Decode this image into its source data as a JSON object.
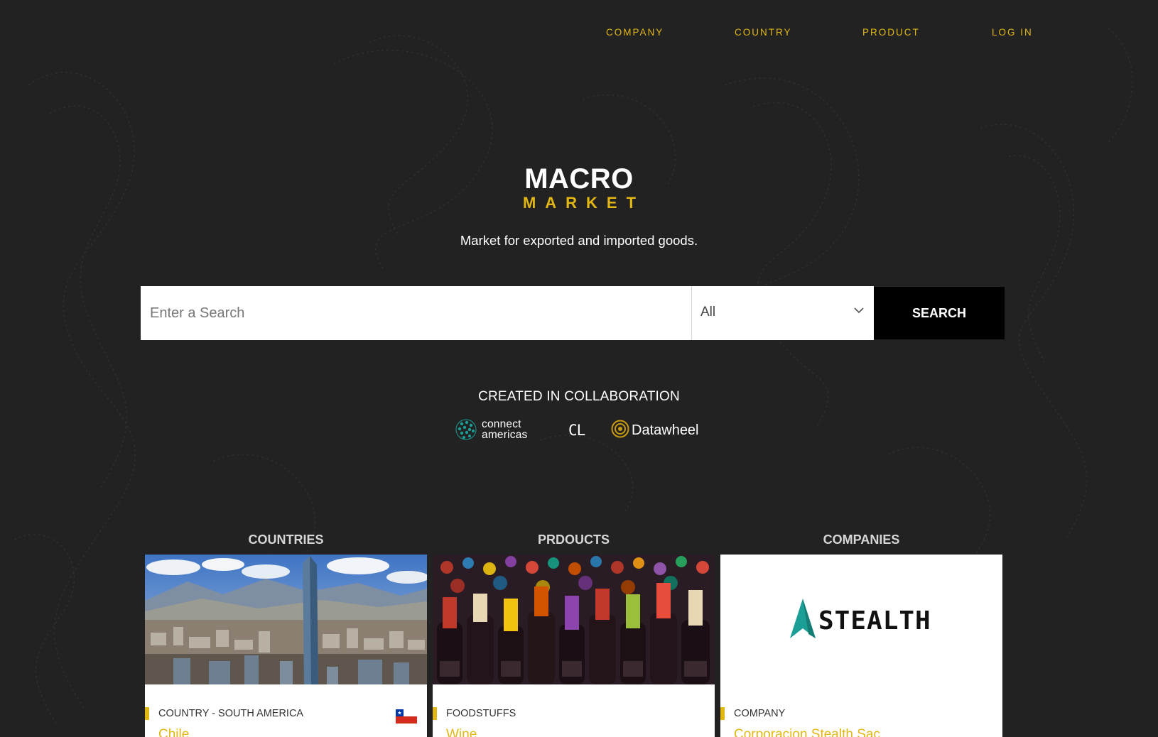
{
  "nav": {
    "company": "COMPANY",
    "country": "COUNTRY",
    "product": "PRODUCT",
    "login": "LOG IN"
  },
  "logo": {
    "line1": "MACRO",
    "line2": "MARKET"
  },
  "tagline": "Market for exported and imported goods.",
  "search": {
    "placeholder": "Enter a Search",
    "category_selected": "All",
    "button_label": "SEARCH"
  },
  "collaboration": {
    "title": "CREATED IN COLLABORATION",
    "partners": {
      "connect_americas_line1": "connect",
      "connect_americas_line2": "americas",
      "cl_mark": "CL",
      "datawheel": "Datawheel"
    }
  },
  "sections": {
    "countries": {
      "title": "COUNTRIES",
      "card": {
        "meta": "COUNTRY - SOUTH AMERICA",
        "name": "Chile",
        "flag": "chile-flag-icon"
      }
    },
    "products": {
      "title": "PRDOUCTS",
      "card": {
        "meta": "FOODSTUFFS",
        "name": "Wine"
      }
    },
    "companies": {
      "title": "COMPANIES",
      "card": {
        "meta": "COMPANY",
        "name": "Corporacion Stealth Sac",
        "logo_text": "STEALTH"
      }
    }
  },
  "colors": {
    "accent": "#e2b714",
    "background": "#222222",
    "teal": "#1a9e96"
  }
}
